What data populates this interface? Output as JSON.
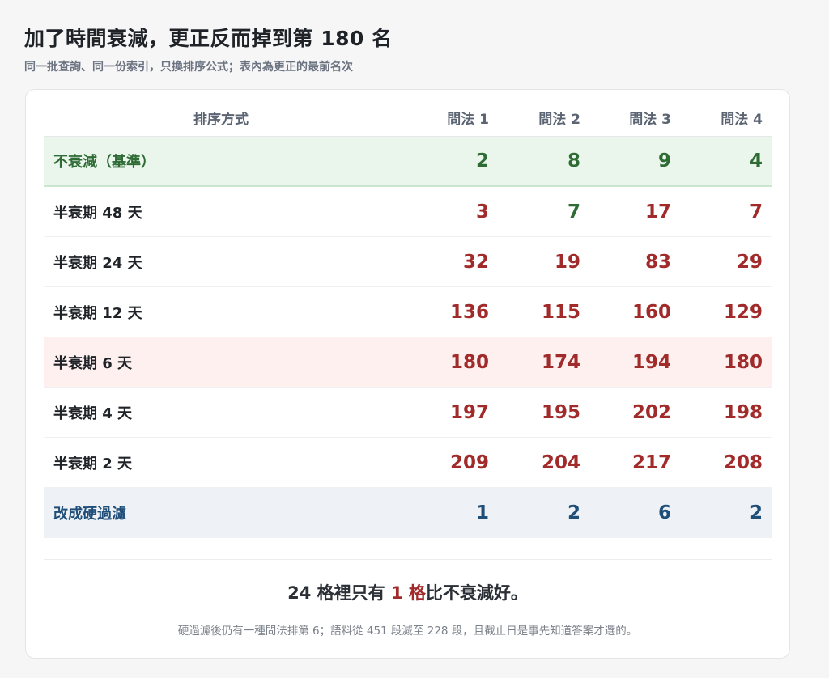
{
  "title": "加了時間衰減，更正反而掉到第 180 名",
  "subtitle": "同一批查詢、同一份索引，只換排序公式；表內為更正的最前名次",
  "table": {
    "headers": [
      "排序方式",
      "問法 1",
      "問法 2",
      "問法 3",
      "問法 4"
    ],
    "rows": [
      {
        "label": "不衰減（基準）",
        "values": [
          2,
          8,
          9,
          4
        ]
      },
      {
        "label": "半衰期 48 天",
        "values": [
          3,
          7,
          17,
          7
        ]
      },
      {
        "label": "半衰期 24 天",
        "values": [
          32,
          19,
          83,
          29
        ]
      },
      {
        "label": "半衰期 12 天",
        "values": [
          136,
          115,
          160,
          129
        ]
      },
      {
        "label": "半衰期 6 天",
        "values": [
          180,
          174,
          194,
          180
        ]
      },
      {
        "label": "半衰期 4 天",
        "values": [
          197,
          195,
          202,
          198
        ]
      },
      {
        "label": "半衰期 2 天",
        "values": [
          209,
          204,
          217,
          208
        ]
      },
      {
        "label": "改成硬過濾",
        "values": [
          1,
          2,
          6,
          2
        ]
      }
    ]
  },
  "summary": {
    "prefix": "24 格裡只有 ",
    "accent": "1 格",
    "suffix": "比不衰減好。"
  },
  "note": "硬過濾後仍有一種問法排第 6；語料從 451 段減至 228 段，且截止日是事先知道答案才選的。",
  "colors": {
    "better": "#2e6b35",
    "worse": "#a12a2a",
    "hard_filter": "#1f4e79"
  }
}
